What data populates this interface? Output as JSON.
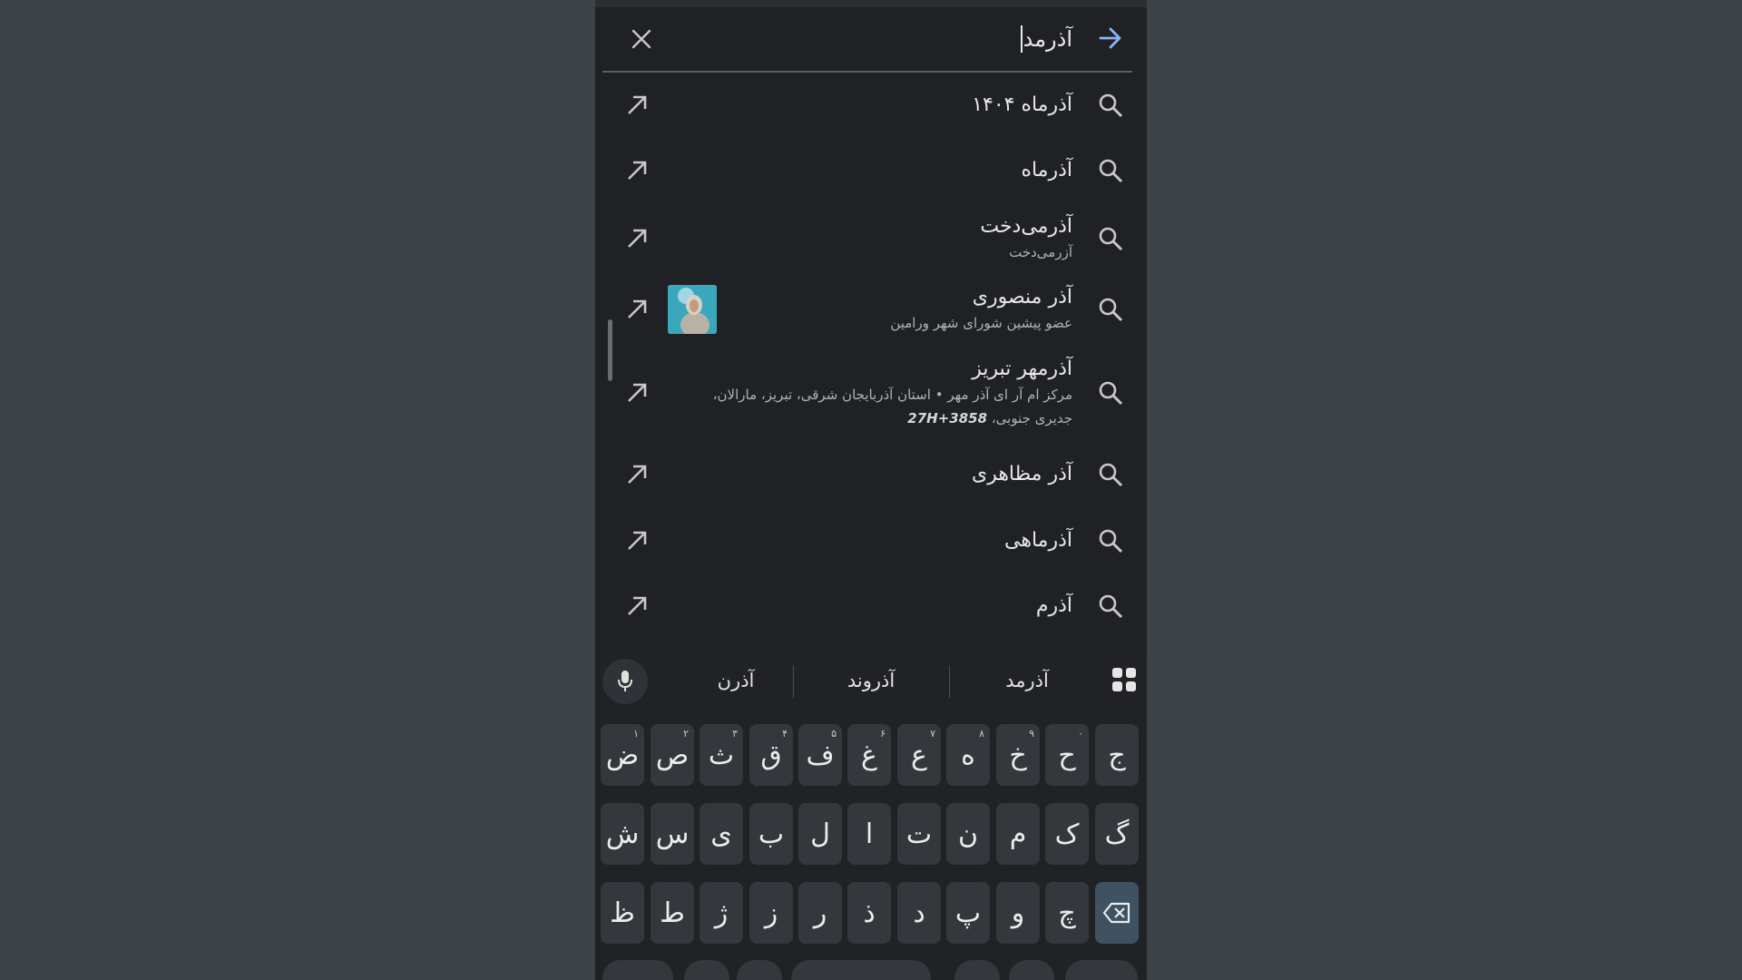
{
  "search": {
    "query": "آذرمد",
    "close_icon": "close-icon",
    "submit_icon": "arrow-right-icon"
  },
  "suggestions": [
    {
      "title": "آذرماه ۱۴۰۴",
      "subtitle": "",
      "subtitle_bold": ""
    },
    {
      "title": "آذرماه",
      "subtitle": "",
      "subtitle_bold": ""
    },
    {
      "title": "آذرمی‌دخت",
      "subtitle": "آزرمی‌دخت",
      "subtitle_bold": ""
    },
    {
      "title": "آذر منصوری",
      "subtitle": "عضو پیشین شورای شهر ورامین",
      "subtitle_bold": ""
    },
    {
      "title": "آذرمهر تبریز",
      "subtitle": "مرکز ام آر ای آذر مهر • استان آذربایجان شرقی، تبریز، مارالان، جدیری جنوبی،",
      "subtitle_bold": "27H+3858"
    },
    {
      "title": "آذر مظاهری",
      "subtitle": "",
      "subtitle_bold": ""
    },
    {
      "title": "آذرماهی",
      "subtitle": "",
      "subtitle_bold": ""
    },
    {
      "title": "آذرم",
      "subtitle": "",
      "subtitle_bold": ""
    }
  ],
  "keyboard": {
    "word_suggestions": [
      "آذرن",
      "آذروند",
      "آذرمد"
    ],
    "row1": [
      {
        "k": "ض",
        "h": "۱"
      },
      {
        "k": "ص",
        "h": "۲"
      },
      {
        "k": "ث",
        "h": "۳"
      },
      {
        "k": "ق",
        "h": "۴"
      },
      {
        "k": "ف",
        "h": "۵"
      },
      {
        "k": "غ",
        "h": "۶"
      },
      {
        "k": "ع",
        "h": "۷"
      },
      {
        "k": "ه",
        "h": "۸"
      },
      {
        "k": "خ",
        "h": "۹"
      },
      {
        "k": "ح",
        "h": "۰"
      },
      {
        "k": "ج",
        "h": ""
      }
    ],
    "row2": [
      "ش",
      "س",
      "ی",
      "ب",
      "ل",
      "ا",
      "ت",
      "ن",
      "م",
      "ک",
      "گ"
    ],
    "row3": [
      "ظ",
      "ط",
      "ژ",
      "ز",
      "ر",
      "ذ",
      "د",
      "پ",
      "و",
      "چ"
    ]
  }
}
